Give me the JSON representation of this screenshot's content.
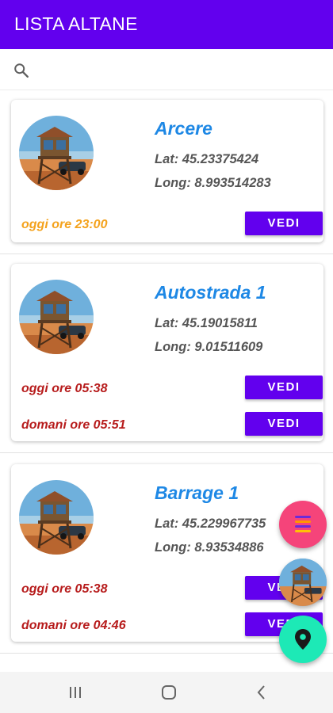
{
  "appbar": {
    "title": "LISTA ALTANE",
    "color": "#6200ee"
  },
  "search": {
    "icon": "search-icon"
  },
  "cards": [
    {
      "name": "Arcere",
      "lat": "Lat: 45.23375424",
      "long": "Long: 8.993514283",
      "times": [
        {
          "text": "oggi ore 23:00",
          "button": "VEDI",
          "color": "orange"
        }
      ]
    },
    {
      "name": "Autostrada 1",
      "lat": "Lat: 45.19015811",
      "long": "Long: 9.01511609",
      "times": [
        {
          "text": "oggi ore 05:38",
          "button": "VEDI",
          "color": "red"
        },
        {
          "text": "domani ore 05:51",
          "button": "VEDI",
          "color": "red"
        }
      ]
    },
    {
      "name": "Barrage 1",
      "lat": "Lat: 45.229967735",
      "long": "Long: 8.93534886",
      "times": [
        {
          "text": "oggi ore 05:38",
          "button": "VEDI",
          "color": "red"
        },
        {
          "text": "domani ore 04:46",
          "button": "VEDI",
          "color": "red"
        }
      ]
    }
  ],
  "fabs": {
    "menu": "menu-icon",
    "avatar": "watchtower-avatar",
    "map": "map-pin-icon"
  },
  "colors": {
    "accent": "#6200ee",
    "name_blue": "#1e88e5",
    "orange": "#f4a21c",
    "red": "#b71c1c",
    "fab_pink": "#f5447a",
    "fab_teal": "#1de9b6"
  },
  "navbar": {
    "recent": "recents-icon",
    "home": "home-icon",
    "back": "back-icon"
  }
}
